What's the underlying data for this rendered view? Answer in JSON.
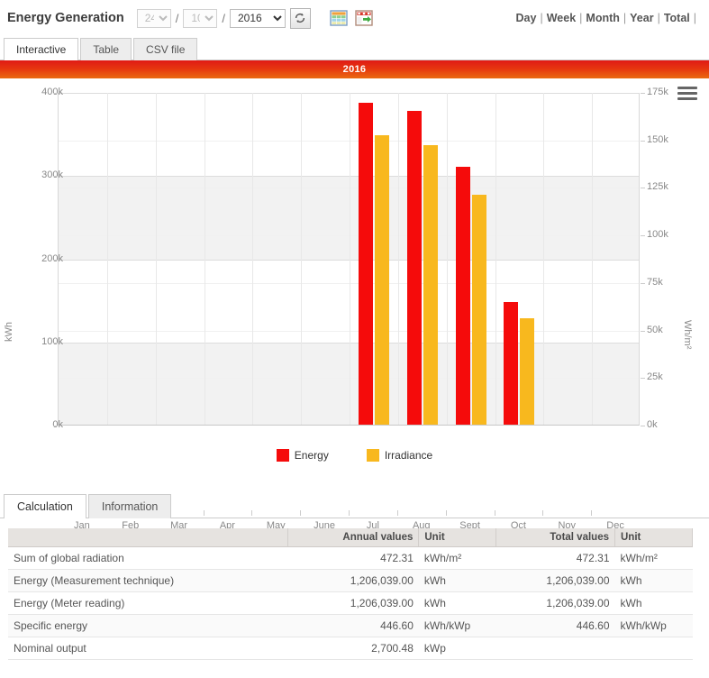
{
  "header": {
    "title": "Energy Generation",
    "day_value": "24",
    "month_value": "10",
    "year_value": "2016",
    "separator": "/",
    "refresh_icon": "refresh-icon",
    "table_icon": "table-export-icon",
    "export_icon": "excel-export-icon",
    "period_links": [
      "Day",
      "Week",
      "Month",
      "Year",
      "Total"
    ],
    "period_separator": "|"
  },
  "top_tabs": [
    {
      "label": "Interactive",
      "active": true
    },
    {
      "label": "Table",
      "active": false
    },
    {
      "label": "CSV file",
      "active": false
    }
  ],
  "chart": {
    "title": "2016",
    "menu_icon": "hamburger-menu-icon"
  },
  "chart_data": {
    "type": "bar",
    "title": "2016",
    "xlabel": "",
    "ylabel": "kWh",
    "y2label": "Wh/m²",
    "categories": [
      "Jan",
      "Feb",
      "Mar",
      "Apr",
      "May",
      "June",
      "Jul",
      "Aug",
      "Sept",
      "Oct",
      "Nov",
      "Dec"
    ],
    "ylim": [
      0,
      400000
    ],
    "y2lim": [
      0,
      175000
    ],
    "yticks": [
      "0k",
      "100k",
      "200k",
      "300k",
      "400k"
    ],
    "y2ticks": [
      "0k",
      "25k",
      "50k",
      "75k",
      "100k",
      "125k",
      "150k",
      "175k"
    ],
    "grid": true,
    "legend_position": "bottom",
    "series": [
      {
        "name": "Energy",
        "axis": "left",
        "unit": "kWh",
        "color": "#f50b0b",
        "values": [
          0,
          0,
          0,
          0,
          0,
          0,
          387000,
          377000,
          310000,
          147000,
          0,
          0
        ]
      },
      {
        "name": "Irradiance",
        "axis": "right",
        "unit": "Wh/m²",
        "color": "#f8b81e",
        "values": [
          0,
          0,
          0,
          0,
          0,
          0,
          152000,
          147000,
          121000,
          56000,
          0,
          0
        ]
      }
    ]
  },
  "bottom_tabs": [
    {
      "label": "Calculation",
      "active": true
    },
    {
      "label": "Information",
      "active": false
    }
  ],
  "calculation_table": {
    "headers": [
      "",
      "Annual values",
      "Unit",
      "Total values",
      "Unit"
    ],
    "rows": [
      {
        "name": "Sum of global radiation",
        "annual_value": "472.31",
        "annual_unit": "kWh/m²",
        "total_value": "472.31",
        "total_unit": "kWh/m²"
      },
      {
        "name": "Energy (Measurement technique)",
        "annual_value": "1,206,039.00",
        "annual_unit": "kWh",
        "total_value": "1,206,039.00",
        "total_unit": "kWh"
      },
      {
        "name": "Energy (Meter reading)",
        "annual_value": "1,206,039.00",
        "annual_unit": "kWh",
        "total_value": "1,206,039.00",
        "total_unit": "kWh"
      },
      {
        "name": "Specific energy",
        "annual_value": "446.60",
        "annual_unit": "kWh/kWp",
        "total_value": "446.60",
        "total_unit": "kWh/kWp"
      },
      {
        "name": "Nominal output",
        "annual_value": "2,700.48",
        "annual_unit": "kWp",
        "total_value": "",
        "total_unit": ""
      }
    ]
  }
}
